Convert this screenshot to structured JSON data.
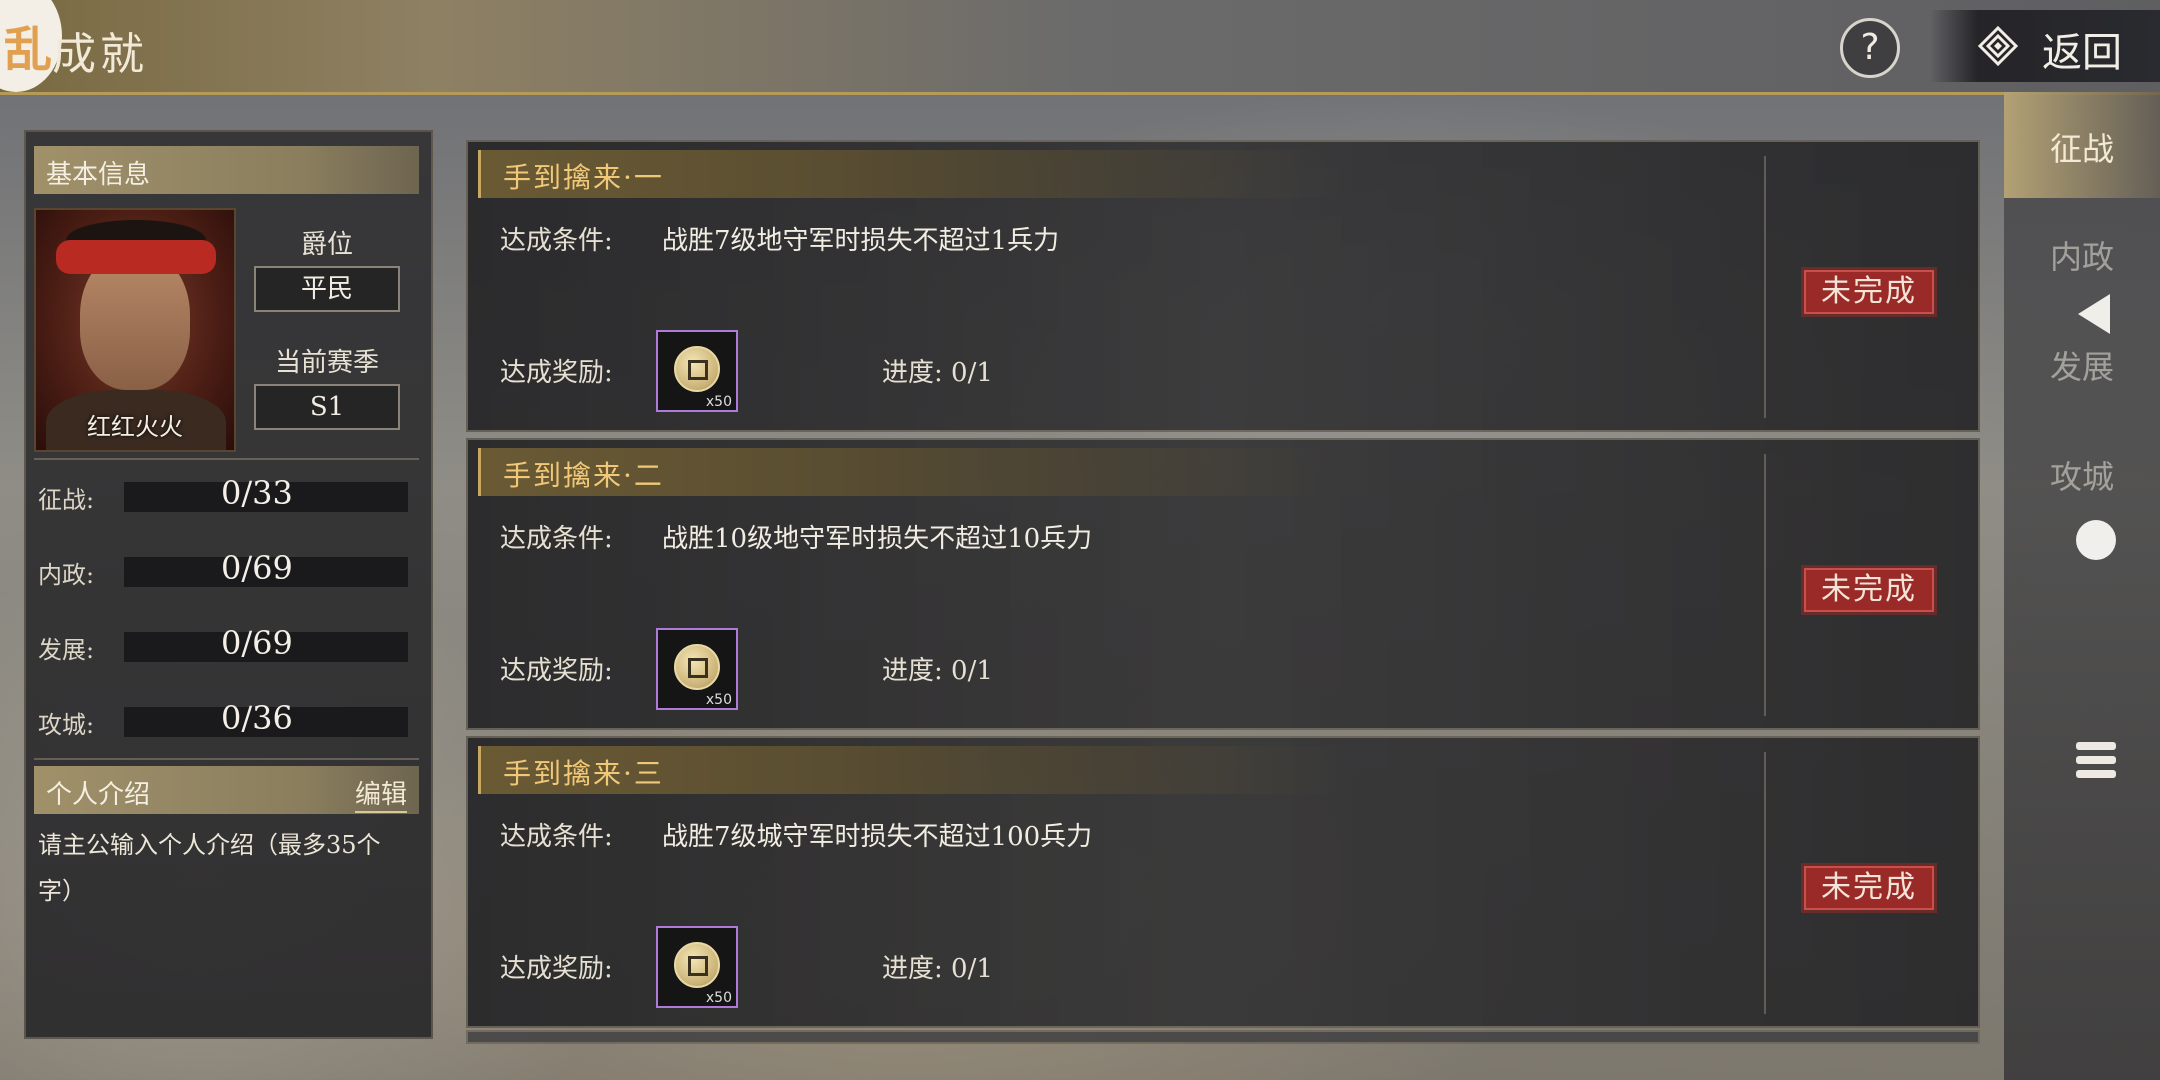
{
  "header": {
    "logo_char": "乱",
    "title": "成就",
    "help_label": "?",
    "back_label": "返回"
  },
  "profile": {
    "section_title": "基本信息",
    "name": "红红火火",
    "rank_label": "爵位",
    "rank_value": "平民",
    "season_label": "当前赛季",
    "season_value": "S1",
    "stats": [
      {
        "label": "征战:",
        "value": "0/33"
      },
      {
        "label": "内政:",
        "value": "0/69"
      },
      {
        "label": "发展:",
        "value": "0/69"
      },
      {
        "label": "攻城:",
        "value": "0/36"
      }
    ],
    "intro_title": "个人介绍",
    "edit_label": "编辑",
    "intro_text": "请主公输入个人介绍（最多35个字）"
  },
  "achievements": [
    {
      "title": "手到擒来·一",
      "condition_label": "达成条件:",
      "condition": "战胜7级地守军时损失不超过1兵力",
      "reward_label": "达成奖励:",
      "reward_count": "x50",
      "progress_label": "进度:",
      "progress": "0/1",
      "status": "未完成"
    },
    {
      "title": "手到擒来·二",
      "condition_label": "达成条件:",
      "condition": "战胜10级地守军时损失不超过10兵力",
      "reward_label": "达成奖励:",
      "reward_count": "x50",
      "progress_label": "进度:",
      "progress": "0/1",
      "status": "未完成"
    },
    {
      "title": "手到擒来·三",
      "condition_label": "达成条件:",
      "condition": "战胜7级城守军时损失不超过100兵力",
      "reward_label": "达成奖励:",
      "reward_count": "x50",
      "progress_label": "进度:",
      "progress": "0/1",
      "status": "未完成"
    }
  ],
  "nav": {
    "tabs": [
      "征战",
      "内政",
      "发展",
      "攻城"
    ],
    "active": "征战"
  }
}
